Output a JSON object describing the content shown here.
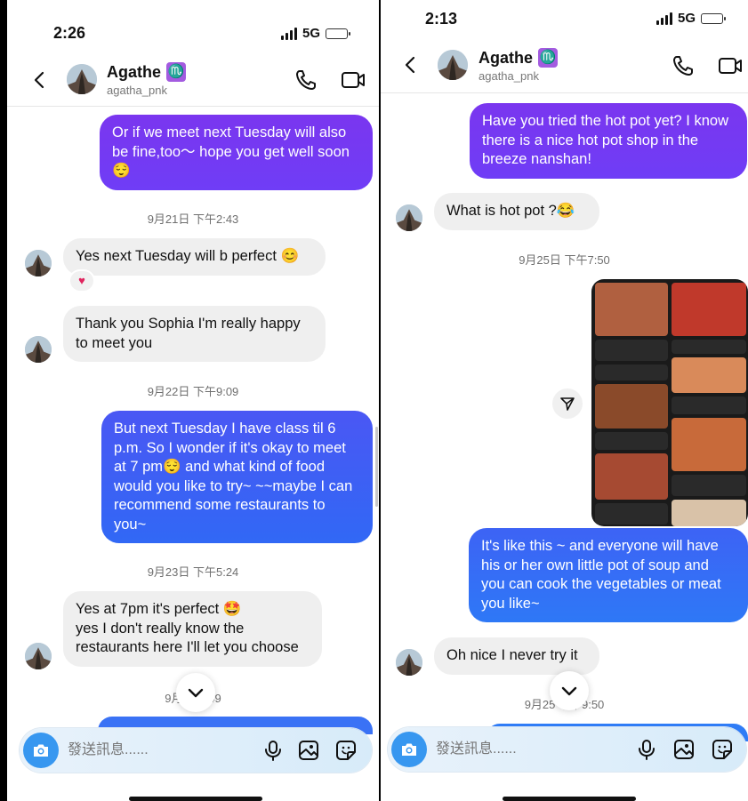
{
  "colors": {
    "out_purple": "#7139f2",
    "out_blue": "#3f5ff5",
    "in_bubble": "#efefef",
    "accent": "#3797f0",
    "reaction": "#e0245e"
  },
  "icons": {
    "back": "chevron-left-icon",
    "call": "phone-icon",
    "video": "video-camera-icon",
    "camera": "camera-icon",
    "mic": "microphone-icon",
    "gallery": "image-icon",
    "sticker": "sticker-icon",
    "scroll": "chevron-down-icon",
    "share": "send-icon"
  },
  "left": {
    "status": {
      "time": "2:26",
      "network": "5G"
    },
    "header": {
      "name": "Agathe",
      "zodiac": "♏",
      "username": "agatha_pnk"
    },
    "messages": [
      {
        "text": "Or if we meet next Tuesday will also be fine,too～ hope you get well soon😌"
      },
      {
        "time": "9月21日 下午2:43"
      },
      {
        "text": "Yes next Tuesday will b perfect 😊",
        "reaction": "♥"
      },
      {
        "text": "Thank you Sophia I'm really happy to meet you"
      },
      {
        "time": "9月22日 下午9:09"
      },
      {
        "text": "But next Tuesday I have class til  6 p.m. So I wonder if it's okay to meet at 7 pm😌  and what kind of food would you like to try~ ~~maybe I can recommend some restaurants to you~"
      },
      {
        "time": "9月23日 下午5:24"
      },
      {
        "text": "Yes at 7pm it's perfect 🤩\nyes I don't really know the restaurants here I'll let you choose"
      },
      {
        "time": "9月25 5:49"
      }
    ],
    "composer": {
      "placeholder": "發送訊息......"
    }
  },
  "right": {
    "status": {
      "time": "2:13",
      "network": "5G"
    },
    "header": {
      "name": "Agathe",
      "zodiac": "♏",
      "username": "agatha_pnk"
    },
    "messages": [
      {
        "text": "Have you tried the hot pot yet? I know there is a  nice hot pot shop in the breeze nanshan!"
      },
      {
        "text": "What is hot pot ?😂"
      },
      {
        "time": "9月25日 下午7:50"
      },
      {
        "text": "It's like this ~ and everyone will have his or her own little pot of soup and you can cook the vegetables or meat you like~"
      },
      {
        "text": "Oh nice I never try it"
      },
      {
        "time": "9月25 下午9:50"
      }
    ],
    "composer": {
      "placeholder": "發送訊息......"
    }
  }
}
